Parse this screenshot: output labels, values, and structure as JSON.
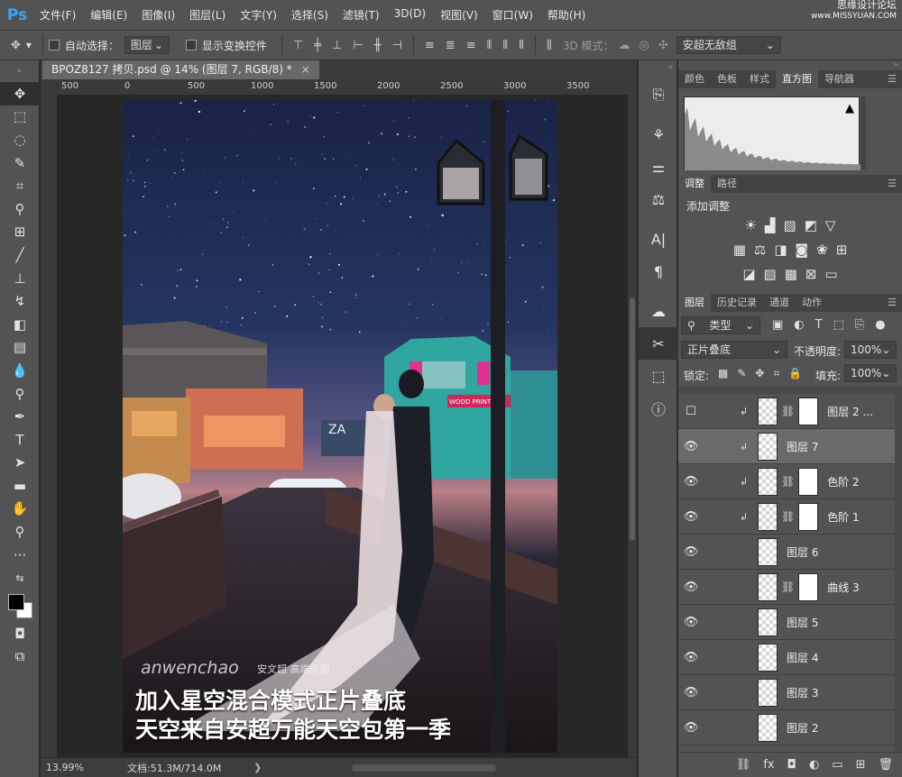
{
  "app": {
    "logo": "Ps"
  },
  "menu": [
    "文件(F)",
    "编辑(E)",
    "图像(I)",
    "图层(L)",
    "文字(Y)",
    "选择(S)",
    "滤镜(T)",
    "3D(D)",
    "视图(V)",
    "窗口(W)",
    "帮助(H)"
  ],
  "watermark": {
    "line1": "思缘设计论坛",
    "line2": "www.MISSYUAN.COM"
  },
  "options": {
    "auto_select_label": "自动选择：",
    "auto_select_value": "图层",
    "show_transform_label": "显示变换控件",
    "mode3d_label": "3D 模式：",
    "workspace": "安超无敌组"
  },
  "document": {
    "tab_title": "BPOZ8127 拷贝.psd @ 14% (图层 7, RGB/8) *",
    "close_glyph": "×",
    "ruler_labels": [
      "500",
      "0",
      "500",
      "1000",
      "1500",
      "2000",
      "2500",
      "3000",
      "3500"
    ]
  },
  "canvas": {
    "caption_line1": "加入星空混合模式正片叠底",
    "caption_line2": "天空来自安超万能天空包第一季",
    "brand": "anwenchao",
    "brand_cn": "安文超 高端修图",
    "sign_text": "ZA",
    "shop_sign": "WOOD PRINT"
  },
  "status": {
    "zoom": "13.99%",
    "doc": "文档:51.3M/714.0M",
    "arrow": "❯"
  },
  "panels": {
    "top_tabs": [
      "颜色",
      "色板",
      "样式",
      "直方图",
      "导航器"
    ],
    "top_active": 3,
    "adj_tabs": [
      "调整",
      "路径"
    ],
    "adj_title": "添加调整",
    "layer_tabs": [
      "图层",
      "历史记录",
      "通道",
      "动作"
    ],
    "filter_kind": "类型",
    "blend_mode": "正片叠底",
    "opacity_label": "不透明度:",
    "opacity_value": "100%",
    "lock_label": "锁定:",
    "fill_label": "填充:",
    "fill_value": "100%"
  },
  "layers": [
    {
      "name": "图层 2 ...",
      "visible": false,
      "clipped": true,
      "mask": true,
      "selected": false
    },
    {
      "name": "图层 7",
      "visible": true,
      "clipped": true,
      "mask": false,
      "selected": true
    },
    {
      "name": "色阶 2",
      "visible": true,
      "clipped": true,
      "mask": true,
      "selected": false
    },
    {
      "name": "色阶 1",
      "visible": true,
      "clipped": true,
      "mask": true,
      "selected": false
    },
    {
      "name": "图层 6",
      "visible": true,
      "clipped": false,
      "mask": false,
      "selected": false
    },
    {
      "name": "曲线 3",
      "visible": true,
      "clipped": false,
      "mask": true,
      "selected": false
    },
    {
      "name": "图层 5",
      "visible": true,
      "clipped": false,
      "mask": false,
      "selected": false
    },
    {
      "name": "图层 4",
      "visible": true,
      "clipped": false,
      "mask": false,
      "selected": false
    },
    {
      "name": "图层 3",
      "visible": true,
      "clipped": false,
      "mask": false,
      "selected": false
    },
    {
      "name": "图层 2",
      "visible": true,
      "clipped": false,
      "mask": false,
      "selected": false
    }
  ],
  "colors": {
    "accent": "#31a8ff",
    "panel": "#535353",
    "dark": "#282828",
    "selected_layer": "#6a6a6a"
  }
}
